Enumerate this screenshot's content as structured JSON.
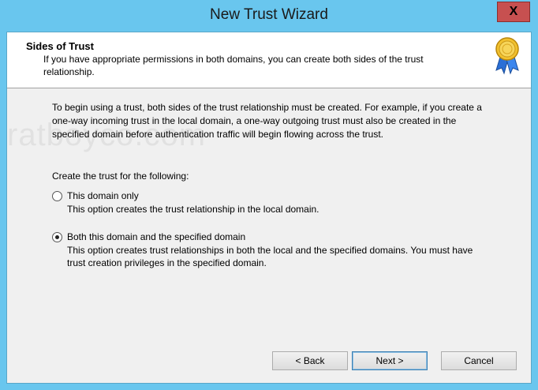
{
  "window": {
    "title": "New Trust Wizard",
    "close_glyph": "X"
  },
  "header": {
    "title": "Sides of Trust",
    "subtitle": "If you have appropriate permissions in both domains, you can create both sides of the trust relationship.",
    "icon": "award-medal-icon"
  },
  "body": {
    "intro": "To begin using a trust, both sides of the trust relationship must be created. For example, if you create a one-way incoming trust in the local domain, a one-way outgoing trust must also be created in the specified domain before authentication traffic will begin flowing across the trust.",
    "create_label": "Create the trust for the following:",
    "options": [
      {
        "label": "This domain only",
        "description": "This option creates the trust relationship in the local domain.",
        "selected": false
      },
      {
        "label": "Both this domain and the specified domain",
        "description": "This option creates trust relationships in both the local and the specified domains. You must have trust creation privileges in the specified domain.",
        "selected": true
      }
    ],
    "watermark": "ratboyco.com"
  },
  "buttons": {
    "back": "< Back",
    "next": "Next >",
    "cancel": "Cancel"
  },
  "colors": {
    "titlebar": "#69c6ee",
    "close_button": "#c75050",
    "dialog_background": "#f0f0f0"
  }
}
